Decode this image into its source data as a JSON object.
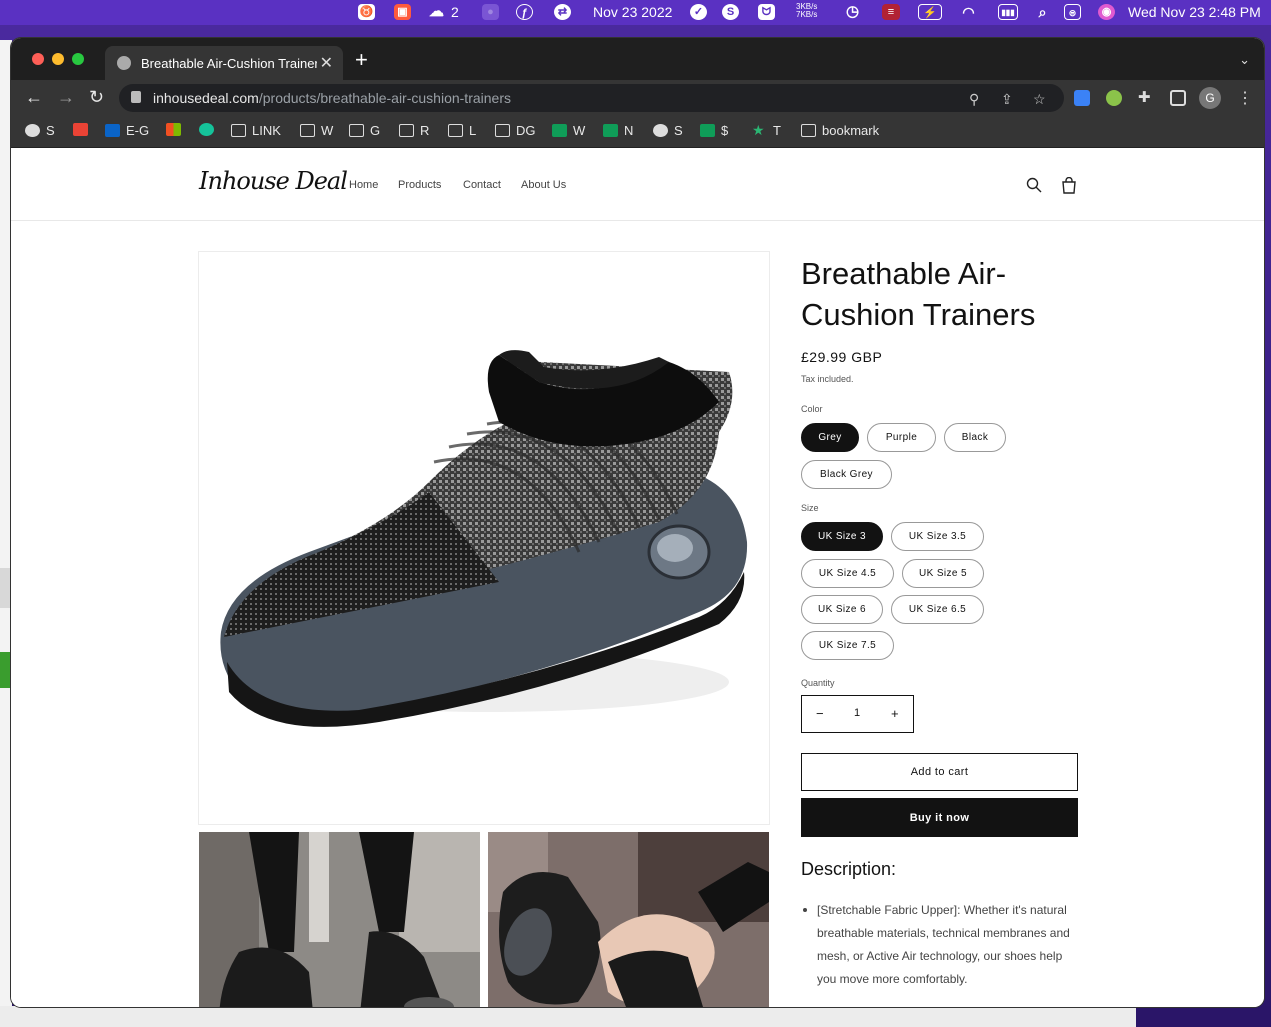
{
  "menubar": {
    "wechat_count": "2",
    "date_left": "Nov 23 2022",
    "net_up": "3KB/s",
    "net_down": "7KB/s",
    "clock": "Wed Nov 23  2:48 PM"
  },
  "browser": {
    "tab_title": "Breathable Air-Cushion Trainers",
    "url_host": "inhousedeal.com",
    "url_path": "/products/breathable-air-cushion-trainers",
    "profile_initial": "G",
    "bookmarks": [
      {
        "label": "S",
        "icon": "globe-icon"
      },
      {
        "label": "",
        "icon": "gmail-icon"
      },
      {
        "label": "E-G",
        "icon": "outlook-icon"
      },
      {
        "label": "",
        "icon": "microsoft-icon"
      },
      {
        "label": "",
        "icon": "grammarly-icon"
      },
      {
        "label": "LINK",
        "icon": "folder-icon"
      },
      {
        "label": "W",
        "icon": "folder-icon"
      },
      {
        "label": "G",
        "icon": "folder-icon"
      },
      {
        "label": "R",
        "icon": "folder-icon"
      },
      {
        "label": "L",
        "icon": "folder-icon"
      },
      {
        "label": "DG",
        "icon": "folder-icon"
      },
      {
        "label": "W",
        "icon": "sheets-icon"
      },
      {
        "label": "N",
        "icon": "sheets-icon"
      },
      {
        "label": "S",
        "icon": "globe-icon"
      },
      {
        "label": "$",
        "icon": "sheets-icon"
      },
      {
        "label": "T",
        "icon": "star-icon"
      },
      {
        "label": "bookmark",
        "icon": "folder-icon"
      }
    ]
  },
  "site": {
    "logo_text": "Inhouse Deal",
    "nav": [
      "Home",
      "Products",
      "Contact",
      "About Us"
    ]
  },
  "product": {
    "title": "Breathable Air-Cushion Trainers",
    "price": "£29.99 GBP",
    "tax_note": "Tax included.",
    "color_label": "Color",
    "colors": [
      "Grey",
      "Purple",
      "Black",
      "Black Grey"
    ],
    "selected_color": "Grey",
    "size_label": "Size",
    "sizes": [
      "UK Size 3",
      "UK Size 3.5",
      "UK Size 4.5",
      "UK Size 5",
      "UK Size 6",
      "UK Size 6.5",
      "UK Size 7.5"
    ],
    "selected_size": "UK Size 3",
    "quantity_label": "Quantity",
    "quantity": "1",
    "minus": "−",
    "plus": "+",
    "add_to_cart": "Add to cart",
    "buy_now": "Buy it now",
    "description_heading": "Description:",
    "description_items": [
      "[Stretchable Fabric Upper]: Whether it's natural breathable materials, technical membranes and mesh, or Active Air technology, our shoes help you move more comfortably."
    ]
  },
  "colors": {
    "menubar": "#5a31c2",
    "chrome_dark": "#1f1f1f",
    "chrome_toolbar": "#353535",
    "accent": "#121212"
  }
}
